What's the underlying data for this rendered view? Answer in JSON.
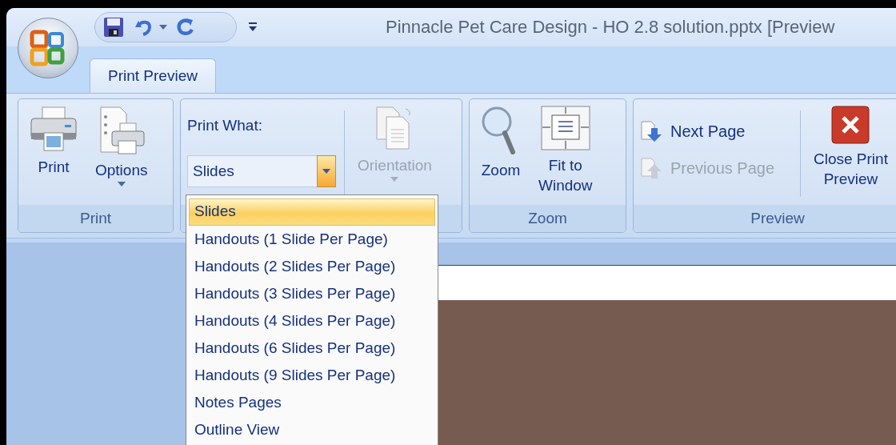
{
  "window": {
    "title": "Pinnacle Pet Care Design - HO 2.8 solution.pptx [Preview"
  },
  "tabs": [
    {
      "label": "Print Preview",
      "selected": true
    }
  ],
  "print_group": {
    "label": "Print",
    "print": "Print",
    "options": "Options"
  },
  "print_what_group": {
    "caption": "Print What:",
    "combo": {
      "value": "Slides",
      "expanded": true
    },
    "orientation": {
      "label": "Orientation",
      "disabled": true
    }
  },
  "zoom_group": {
    "label": "Zoom",
    "zoom": "Zoom",
    "fit_lines": [
      "Fit to",
      "Window"
    ]
  },
  "preview_group": {
    "label": "Preview",
    "next": {
      "label": "Next Page",
      "disabled": false
    },
    "previous": {
      "label": "Previous Page",
      "disabled": true
    },
    "close_lines": [
      "Close Print",
      "Preview"
    ]
  },
  "dropdown": {
    "items": [
      {
        "label": "Slides",
        "selected": true
      },
      {
        "label": "Handouts (1 Slide Per Page)",
        "selected": false
      },
      {
        "label": "Handouts (2 Slides Per Page)",
        "selected": false
      },
      {
        "label": "Handouts (3 Slides Per Page)",
        "selected": false
      },
      {
        "label": "Handouts (4 Slides Per Page)",
        "selected": false
      },
      {
        "label": "Handouts (6 Slides Per Page)",
        "selected": false
      },
      {
        "label": "Handouts (9 Slides Per Page)",
        "selected": false
      },
      {
        "label": "Notes Pages",
        "selected": false
      },
      {
        "label": "Outline View",
        "selected": false
      }
    ]
  }
}
